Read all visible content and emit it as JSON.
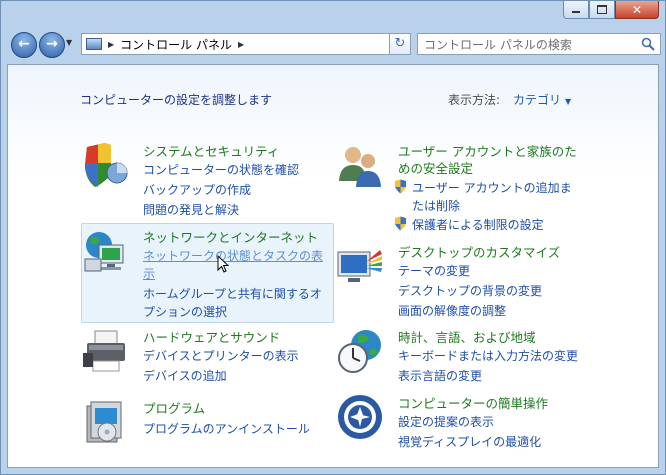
{
  "breadcrumb": {
    "segment": "コントロール パネル"
  },
  "search": {
    "placeholder": "コントロール パネルの検索"
  },
  "header": {
    "title": "コンピューターの設定を調整します",
    "view_label": "表示方法:",
    "view_value": "カテゴリ"
  },
  "categories": {
    "system": {
      "title": "システムとセキュリティ",
      "links": [
        "コンピューターの状態を確認",
        "バックアップの作成",
        "問題の発見と解決"
      ]
    },
    "network": {
      "title": "ネットワークとインターネット",
      "links": [
        "ネットワークの状態とタスクの表",
        "示",
        "ホームグループと共有に関するオ",
        "プションの選択"
      ]
    },
    "hardware": {
      "title": "ハードウェアとサウンド",
      "links": [
        "デバイスとプリンターの表示",
        "デバイスの追加"
      ]
    },
    "programs": {
      "title": "プログラム",
      "links": [
        "プログラムのアンインストール"
      ]
    },
    "users": {
      "title_line1": "ユーザー アカウントと家族のた",
      "title_line2": "めの安全設定",
      "links": [
        "ユーザー アカウントの追加ま",
        "たは削除",
        "保護者による制限の設定"
      ]
    },
    "appearance": {
      "title": "デスクトップのカスタマイズ",
      "links": [
        "テーマの変更",
        "デスクトップの背景の変更",
        "画面の解像度の調整"
      ]
    },
    "clock": {
      "title": "時計、言語、および地域",
      "links": [
        "キーボードまたは入力方法の変更",
        "表示言語の変更"
      ]
    },
    "ease": {
      "title": "コンピューターの簡単操作",
      "links": [
        "設定の提案の表示",
        "視覚ディスプレイの最適化"
      ]
    }
  }
}
